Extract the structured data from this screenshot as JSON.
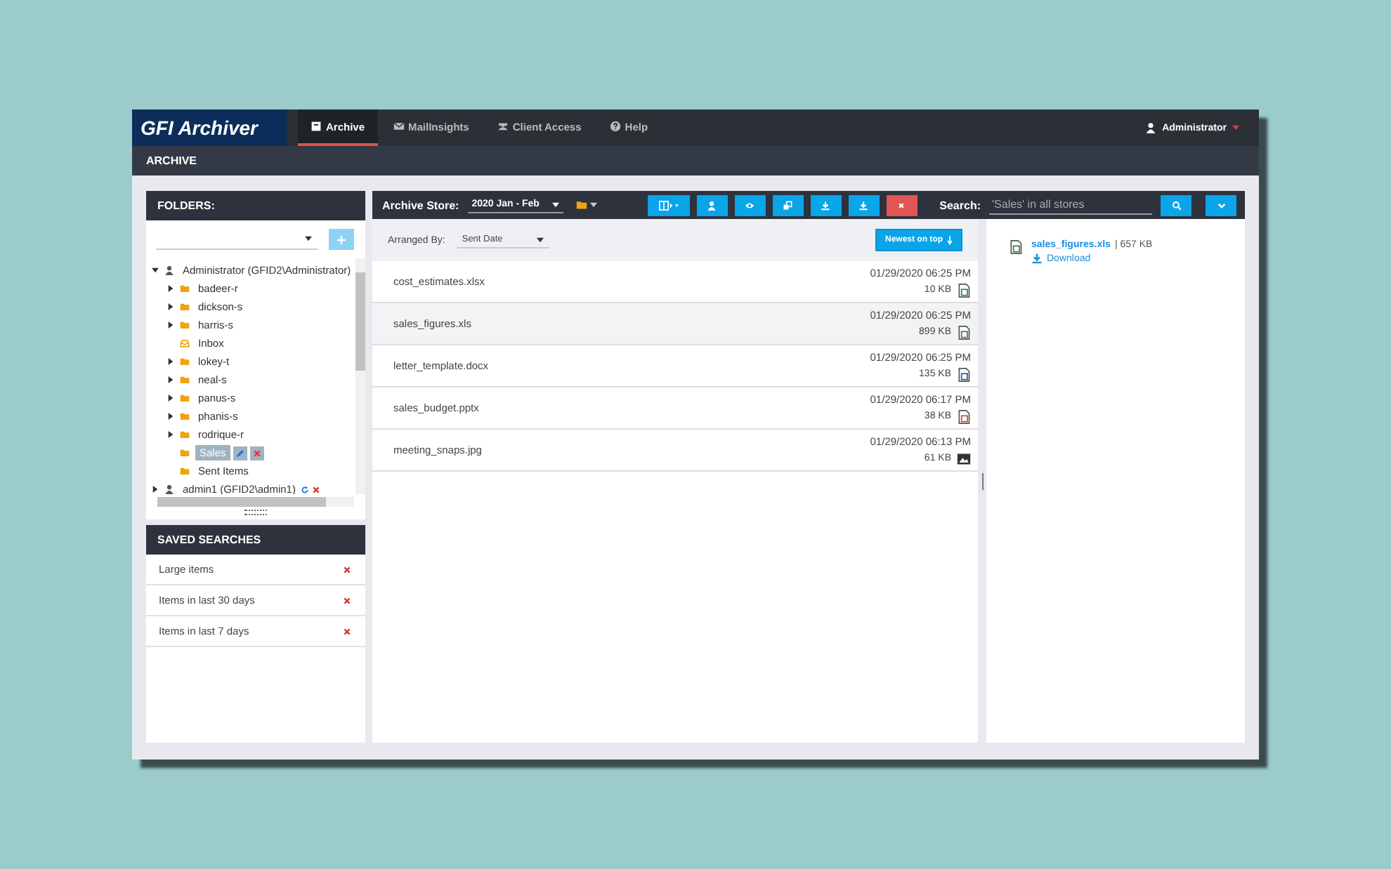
{
  "app": {
    "logo": "GFI Archiver",
    "tabs": [
      {
        "label": "Archive",
        "kind": "archive",
        "selected": true
      },
      {
        "label": "MailInsights",
        "kind": "mail",
        "selected": false
      },
      {
        "label": "Client Access",
        "kind": "users",
        "selected": false
      },
      {
        "label": "Help",
        "kind": "help",
        "selected": false
      }
    ],
    "user": "Administrator"
  },
  "page_title": "ARCHIVE",
  "folders": {
    "title": "FOLDERS:",
    "tree": [
      {
        "label": "Administrator (GFID2\\Administrator)",
        "kind": "user",
        "expanded": true,
        "selected": false,
        "children": [
          {
            "label": "badeer-r",
            "kind": "folder",
            "expanded": false,
            "selected": false
          },
          {
            "label": "dickson-s",
            "kind": "folder",
            "expanded": false,
            "selected": false
          },
          {
            "label": "harris-s",
            "kind": "folder",
            "expanded": false,
            "selected": false
          },
          {
            "label": "Inbox",
            "kind": "inbox",
            "selected": false
          },
          {
            "label": "lokey-t",
            "kind": "folder",
            "expanded": false,
            "selected": false
          },
          {
            "label": "neal-s",
            "kind": "folder",
            "expanded": false,
            "selected": false
          },
          {
            "label": "panus-s",
            "kind": "folder",
            "expanded": false,
            "selected": false
          },
          {
            "label": "phanis-s",
            "kind": "folder",
            "expanded": false,
            "selected": false
          },
          {
            "label": "rodrique-r",
            "kind": "folder",
            "expanded": false,
            "selected": false
          },
          {
            "label": "Sales",
            "kind": "folder",
            "selected": true,
            "editable": true,
            "deletable": true
          },
          {
            "label": "Sent Items",
            "kind": "folder",
            "selected": false
          }
        ]
      },
      {
        "label": "admin1 (GFID2\\admin1)",
        "kind": "user",
        "expanded": false,
        "selected": false,
        "refreshable": true,
        "deletable": true
      }
    ]
  },
  "saved_searches": {
    "title": "SAVED SEARCHES",
    "items": [
      "Large items",
      "Items in last 30 days",
      "Items in last 7 days"
    ]
  },
  "toolbar": {
    "store_label": "Archive Store:",
    "store": "2020 Jan - Feb",
    "search_label": "Search:",
    "search_placeholder": "'Sales' in all stores"
  },
  "sort": {
    "label": "Arranged By:",
    "value": "Sent Date",
    "order": "Newest on top"
  },
  "files": [
    {
      "name": "cost_estimates.xlsx",
      "date": "01/29/2020 06:25 PM",
      "size": "10 KB",
      "kind": "excel",
      "selected": false
    },
    {
      "name": "sales_figures.xls",
      "date": "01/29/2020 06:25 PM",
      "size": "899 KB",
      "kind": "excel",
      "selected": true
    },
    {
      "name": "letter_template.docx",
      "date": "01/29/2020 06:25 PM",
      "size": "135 KB",
      "kind": "word",
      "selected": false
    },
    {
      "name": "sales_budget.pptx",
      "date": "01/29/2020 06:17 PM",
      "size": "38 KB",
      "kind": "powerpoint",
      "selected": false
    },
    {
      "name": "meeting_snaps.jpg",
      "date": "01/29/2020 06:13 PM",
      "size": "61 KB",
      "kind": "image",
      "selected": false
    }
  ],
  "preview": {
    "file": "sales_figures.xls",
    "size": "| 657 KB",
    "kind": "excel",
    "download": "Download"
  }
}
